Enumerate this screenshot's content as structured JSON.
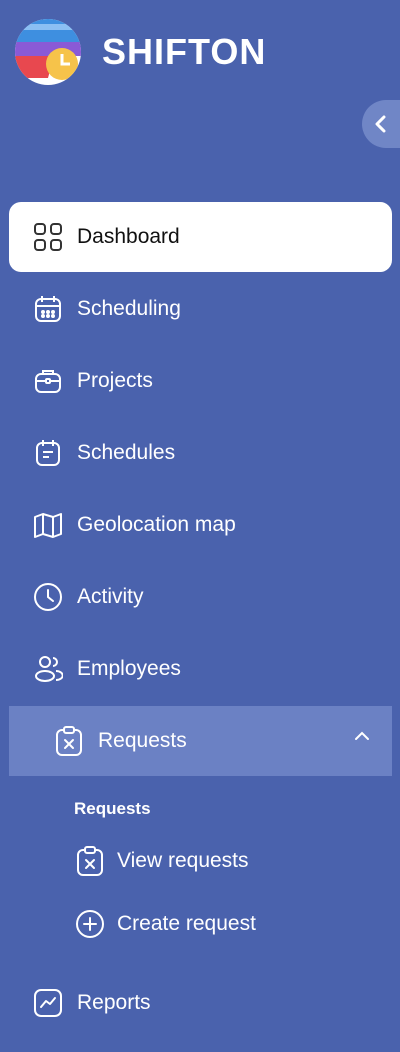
{
  "brand": {
    "name": "SHIFTON"
  },
  "sidebar": {
    "collapse_icon": "chevron-left-icon",
    "items": [
      {
        "label": "Dashboard",
        "icon": "grid-icon",
        "active": true
      },
      {
        "label": "Scheduling",
        "icon": "calendar-icon"
      },
      {
        "label": "Projects",
        "icon": "briefcase-icon"
      },
      {
        "label": "Schedules",
        "icon": "schedule-icon"
      },
      {
        "label": "Geolocation map",
        "icon": "map-icon"
      },
      {
        "label": "Activity",
        "icon": "clock-icon"
      },
      {
        "label": "Employees",
        "icon": "users-icon"
      },
      {
        "label": "Requests",
        "icon": "clipboard-x-icon",
        "expanded": true
      },
      {
        "label": "Reports",
        "icon": "chart-icon"
      }
    ],
    "requests_submenu": {
      "title": "Requests",
      "items": [
        {
          "label": "View requests",
          "icon": "clipboard-x-icon"
        },
        {
          "label": "Create request",
          "icon": "plus-circle-icon"
        }
      ]
    }
  },
  "colors": {
    "sidebar_bg": "#4a62ad",
    "active_bg": "#ffffff",
    "expanded_bg": "#6b81c4"
  }
}
